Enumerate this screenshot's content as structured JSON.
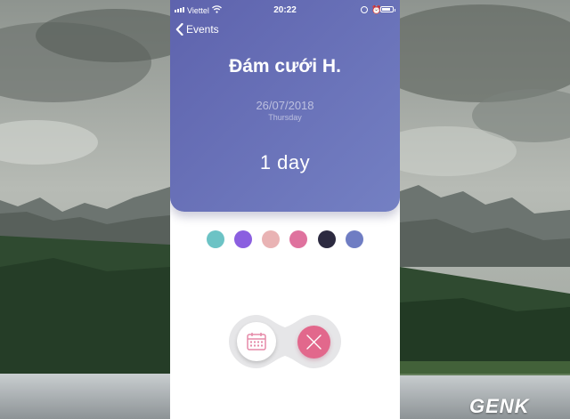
{
  "status_bar": {
    "carrier": "Viettel",
    "time": "20:22",
    "battery_level": 0.8
  },
  "nav": {
    "back_label": "Events"
  },
  "event": {
    "title": "Đám cưới H.",
    "date": "26/07/2018",
    "weekday": "Thursday",
    "countdown": "1 day"
  },
  "colors": {
    "header_gradient": [
      "#5e63ad",
      "#7480c3"
    ],
    "swatches": [
      "#6cc3c5",
      "#8b5fe0",
      "#e9b3b4",
      "#df729e",
      "#2c2a40",
      "#6f7dc3"
    ],
    "delete_button": "#e2688c"
  },
  "actions": {
    "calendar_icon": "calendar-icon",
    "delete_icon": "close-icon"
  },
  "watermark": "GENK"
}
